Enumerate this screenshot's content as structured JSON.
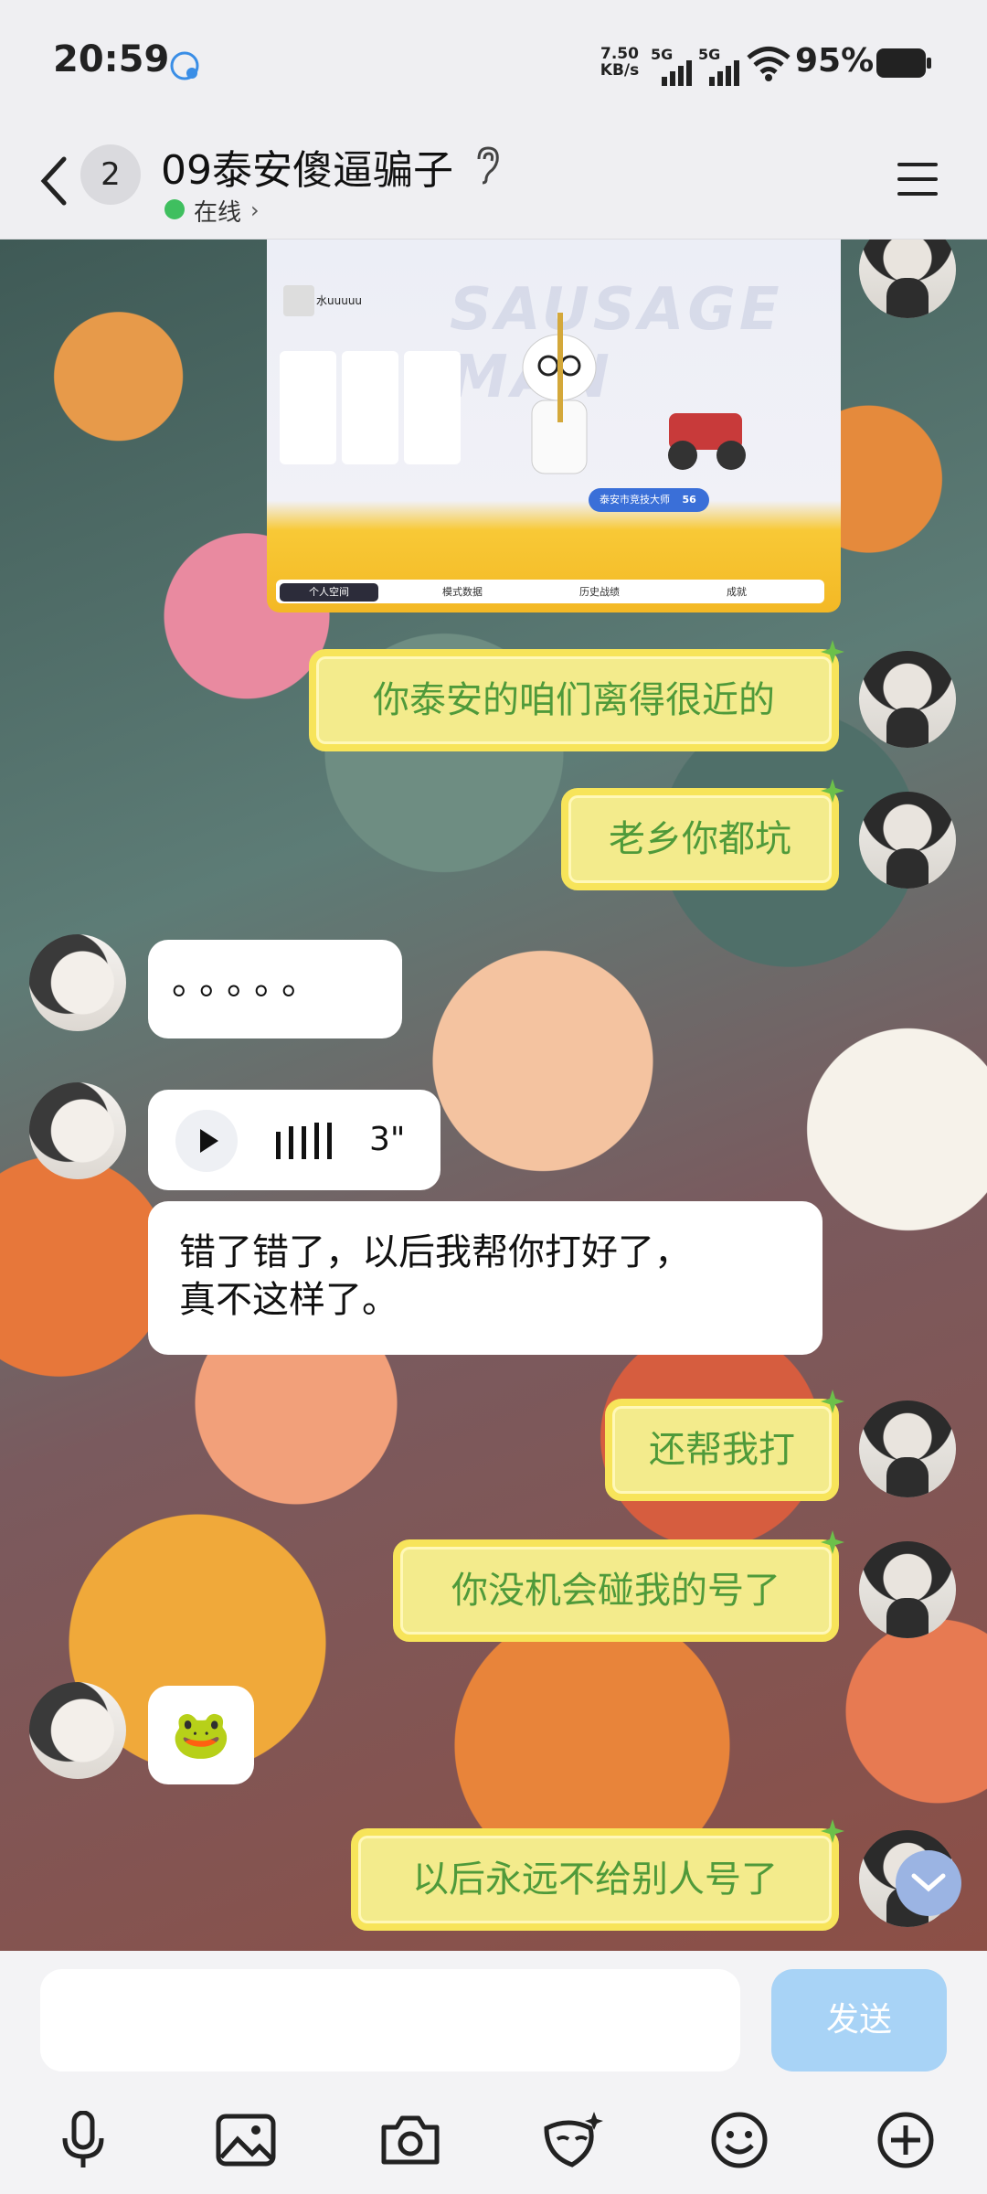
{
  "status_bar": {
    "time": "20:59",
    "net_speed_value": "7.50",
    "net_speed_unit": "KB/s",
    "signal_1_label": "5G",
    "signal_2_label": "5G",
    "battery_percent": "95%"
  },
  "header": {
    "unread_count": "2",
    "title": "09泰安傻逼骗子",
    "status": "在线"
  },
  "image_message": {
    "player_name": "水uuuuu",
    "tabs": [
      "个人空间",
      "模式数据",
      "历史战绩",
      "成就"
    ],
    "level_label": "泰安市竞技大师",
    "level_value": "56"
  },
  "messages": [
    {
      "side": "me",
      "text": "你泰安的咱们离得很近的"
    },
    {
      "side": "me",
      "text": "老乡你都坑"
    },
    {
      "side": "them",
      "text": "。。。。。"
    },
    {
      "side": "them",
      "type": "voice",
      "duration": "3\""
    },
    {
      "side": "them",
      "text_line1": "错了错了，以后我帮你打好了，",
      "text_line2": "真不这样了。"
    },
    {
      "side": "me",
      "text": "还帮我打"
    },
    {
      "side": "me",
      "text": "你没机会碰我的号了"
    },
    {
      "side": "them",
      "type": "emoji",
      "text": "🐸"
    },
    {
      "side": "me",
      "text": "以后永远不给别人号了"
    }
  ],
  "input": {
    "placeholder": "",
    "send_label": "发送"
  },
  "colors": {
    "accent": "#a8d3f6",
    "online": "#3fbf5f",
    "bubble_me_text": "#4f9a3a",
    "bubble_me_bg": "#f3eb8c"
  }
}
